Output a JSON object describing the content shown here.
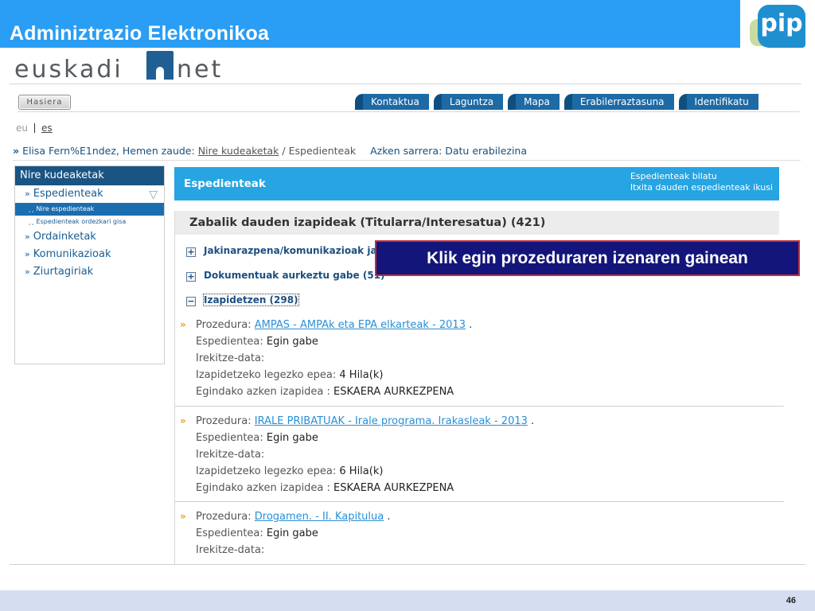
{
  "slide": {
    "title": "Adminiztrazio Elektronikoa",
    "logo_text": "pip",
    "page_number": "46"
  },
  "brand": {
    "left": "euskadi",
    "right": "net"
  },
  "nav": {
    "home": "Hasiera",
    "tabs": [
      "Kontaktua",
      "Laguntza",
      "Mapa",
      "Erabilerraztasuna",
      "Identifikatu"
    ]
  },
  "lang": {
    "eu": "eu",
    "es": "es"
  },
  "breadcrumb": {
    "prefix": "»",
    "user": "Elisa Fern%E1ndez, Hemen zaude:",
    "link": "Nire kudeaketak",
    "separator": "/",
    "current": "Espedienteak",
    "last_access": "Azken sarrera: Datu erabilezina"
  },
  "sidebar": {
    "heading": "Nire kudeaketak",
    "items": [
      {
        "label": "Espedienteak"
      },
      {
        "label": "Ordainketak"
      },
      {
        "label": "Komunikazioak"
      },
      {
        "label": "Ziurtagiriak"
      }
    ],
    "subitems": [
      {
        "label": "Nire espedienteak"
      },
      {
        "label": "Espedienteak ordezkari gisa"
      }
    ],
    "quote": "»",
    "subquote": "¸¸"
  },
  "main": {
    "title": "Espedienteak",
    "link_search": "Espedienteak bilatu",
    "link_closed": "Itxita dauden espedienteak ikusi",
    "open_heading": "Zabalik dauden izapideak (Titularra/Interesatua) (421)",
    "groups": [
      {
        "label": "Jakinarazpena/komunikazioak jaso",
        "toggle": "+"
      },
      {
        "label": "Dokumentuak aurkeztu gabe (51)",
        "toggle": "+"
      },
      {
        "label": "Izapidetzen (298)",
        "toggle": "−"
      }
    ],
    "field_labels": {
      "procedure": "Prozedura:",
      "file": "Espedientea:",
      "opened": "Irekitze-data:",
      "deadline": "Izapidetzeko legezko epea:",
      "last_step": "Egindako azken izapidea :"
    },
    "entries": [
      {
        "procedure": "AMPAS - AMPAk eta EPA elkarteak - 2013",
        "file": "Egin gabe",
        "opened": "",
        "deadline": "4 Hila(k)",
        "last_step": "ESKAERA AURKEZPENA"
      },
      {
        "procedure": "IRALE PRIBATUAK - Irale programa. Irakasleak - 2013",
        "file": "Egin gabe",
        "opened": "",
        "deadline": "6 Hila(k)",
        "last_step": "ESKAERA AURKEZPENA"
      },
      {
        "procedure": "Drogamen. - II. Kapitulua",
        "file": "Egin gabe",
        "opened": ""
      }
    ],
    "arrow": "»",
    "period": "."
  },
  "callout": {
    "text": "Klik egin prozeduraren izenaren gainean"
  },
  "colors": {
    "header": "#2a9df4",
    "nav_tab": "#1d6aa5",
    "sidebar_head": "#1a5483",
    "main_bar": "#27a4e2",
    "callout_bg": "#14157a",
    "callout_border": "#c0303a",
    "footer": "#d5def0"
  }
}
